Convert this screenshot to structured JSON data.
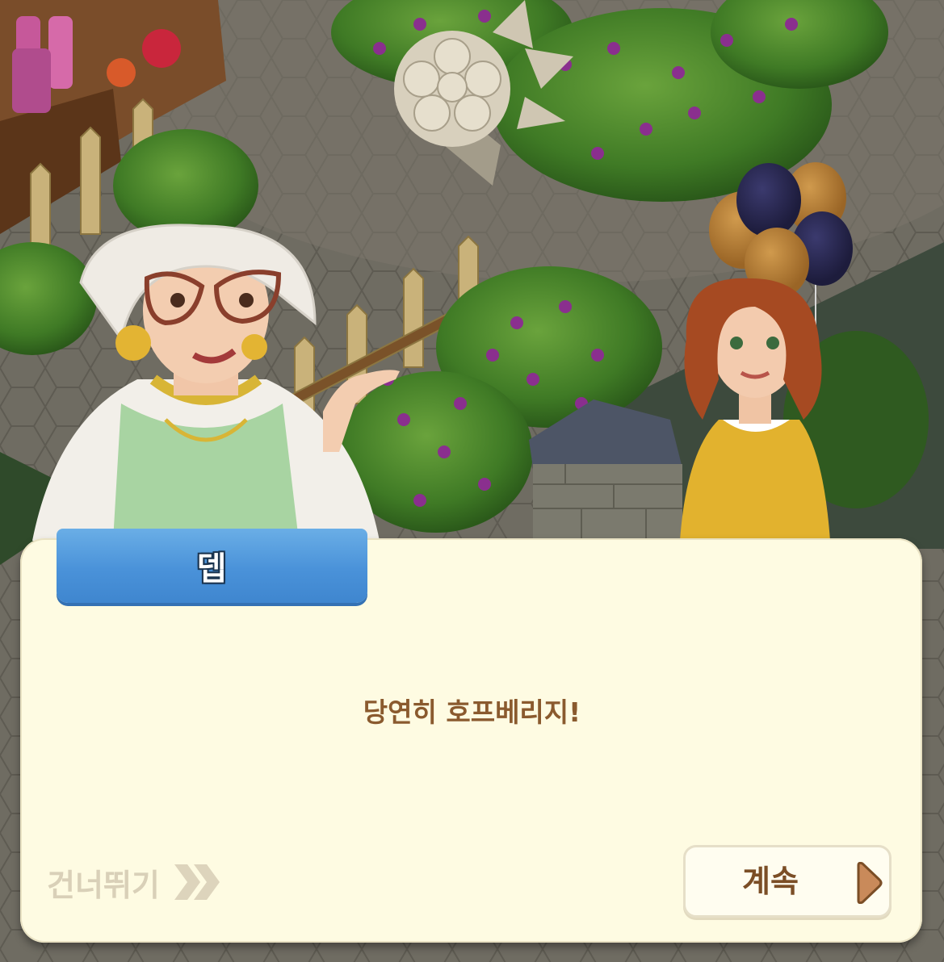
{
  "dialog": {
    "speaker_name": "뎁",
    "message": "당연히 호프베리지!",
    "skip_label": "건너뛰기",
    "continue_label": "계속"
  },
  "icons": {
    "skip": "double-chevron-right-icon",
    "continue": "play-triangle-icon"
  },
  "colors": {
    "dialog_background": "#fefbe2",
    "name_tab": "#4a92d9",
    "message_text": "#8a5a2e",
    "continue_text": "#7b4e26",
    "skip_text": "#d9d0b8"
  }
}
